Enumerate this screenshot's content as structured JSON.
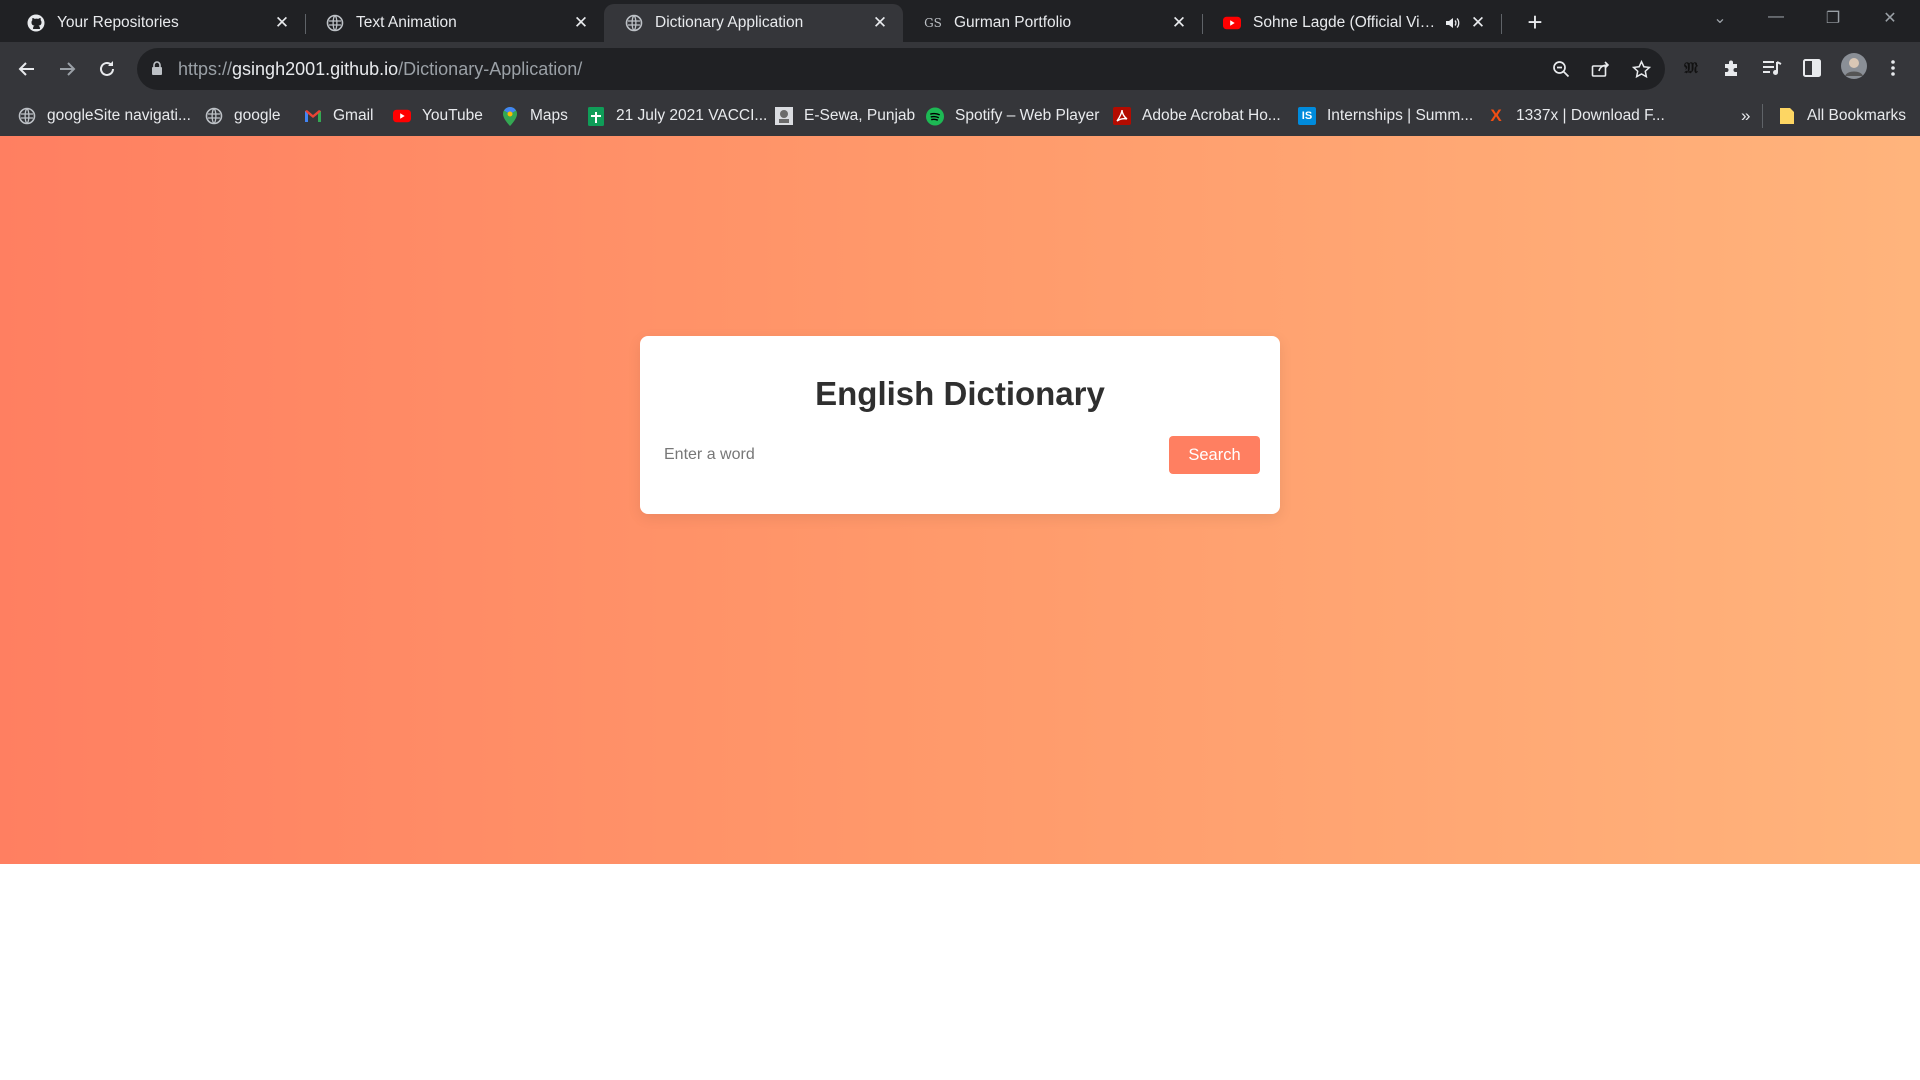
{
  "browser": {
    "tabs": [
      {
        "title": "Your Repositories",
        "favicon": "github-icon",
        "active": false
      },
      {
        "title": "Text Animation",
        "favicon": "globe-icon",
        "active": false
      },
      {
        "title": "Dictionary Application",
        "favicon": "globe-icon",
        "active": true
      },
      {
        "title": "Gurman Portfolio",
        "favicon": "gs-logo-icon",
        "favicon_text": "GS",
        "active": false
      },
      {
        "title": "Sohne Lagde (Official Video",
        "favicon": "youtube-icon",
        "active": false,
        "audio": "speaker-icon"
      }
    ],
    "close_glyph": "✕",
    "new_tab_glyph": "+",
    "window_controls": {
      "minimize": "—",
      "restore": "❐",
      "close": "✕",
      "tab_search": "⌄"
    },
    "address": {
      "scheme": "https://",
      "host": "gsingh2001.github.io",
      "path": "/Dictionary-Application/"
    },
    "bookmarks": [
      {
        "label": "googleSite navigati...",
        "icon": "globe-icon"
      },
      {
        "label": "google",
        "icon": "globe-icon"
      },
      {
        "label": "Gmail",
        "icon": "gmail-icon"
      },
      {
        "label": "YouTube",
        "icon": "youtube-icon"
      },
      {
        "label": "Maps",
        "icon": "maps-pin-icon"
      },
      {
        "label": "21 July 2021 VACCI...",
        "icon": "sheets-icon"
      },
      {
        "label": "E-Sewa, Punjab",
        "icon": "emblem-icon"
      },
      {
        "label": "Spotify – Web Player",
        "icon": "spotify-icon"
      },
      {
        "label": "Adobe Acrobat Ho...",
        "icon": "acrobat-icon"
      },
      {
        "label": "Internships | Summ...",
        "icon": "internshala-icon",
        "icon_text": "IS"
      },
      {
        "label": "1337x | Download F...",
        "icon": "x-logo-icon",
        "icon_text": "X"
      }
    ],
    "bookmarks_overflow": "»",
    "all_bookmarks": "All Bookmarks",
    "colors": {
      "tabstrip": "#202124",
      "toolbar": "#35363a",
      "text": "#e8eaed"
    }
  },
  "app": {
    "title": "English Dictionary",
    "search": {
      "placeholder": "Enter a word",
      "value": ""
    },
    "search_button": "Search",
    "colors": {
      "gradient_start": "#ff7f61",
      "gradient_end": "#ffb47c",
      "button": "#ff7f61",
      "card": "#ffffff"
    }
  }
}
